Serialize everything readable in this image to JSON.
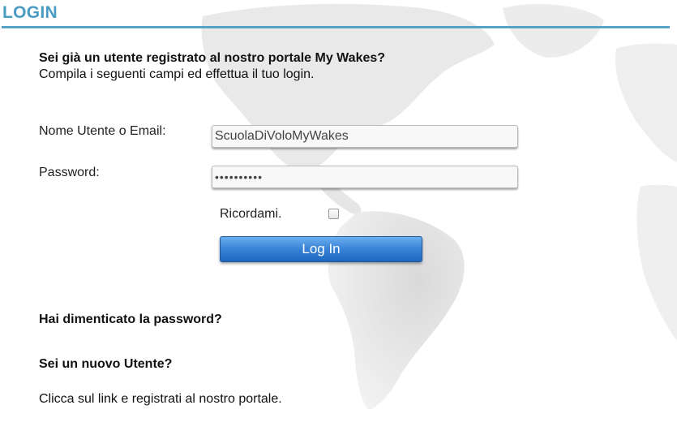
{
  "page": {
    "title": "LOGIN",
    "accent_color": "#4a9bc1",
    "background": "world-map-watermark"
  },
  "intro": {
    "question": "Sei già un utente registrato al nostro portale My Wakes?",
    "instruction": "Compila i seguenti campi ed effettua il tuo login."
  },
  "form": {
    "username_label": "Nome Utente o Email:",
    "username_value": "ScuolaDiVoloMyWakes",
    "password_label": "Password:",
    "password_value": "••••••••••",
    "remember_label": "Ricordami.",
    "remember_checked": false,
    "login_button": "Log In",
    "login_button_color": "#2f7bd1"
  },
  "links": {
    "forgot_password": "Hai dimenticato la password?",
    "new_user_heading": "Sei un nuovo Utente?",
    "register_text": "Clicca sul link e registrati al nostro portale."
  }
}
